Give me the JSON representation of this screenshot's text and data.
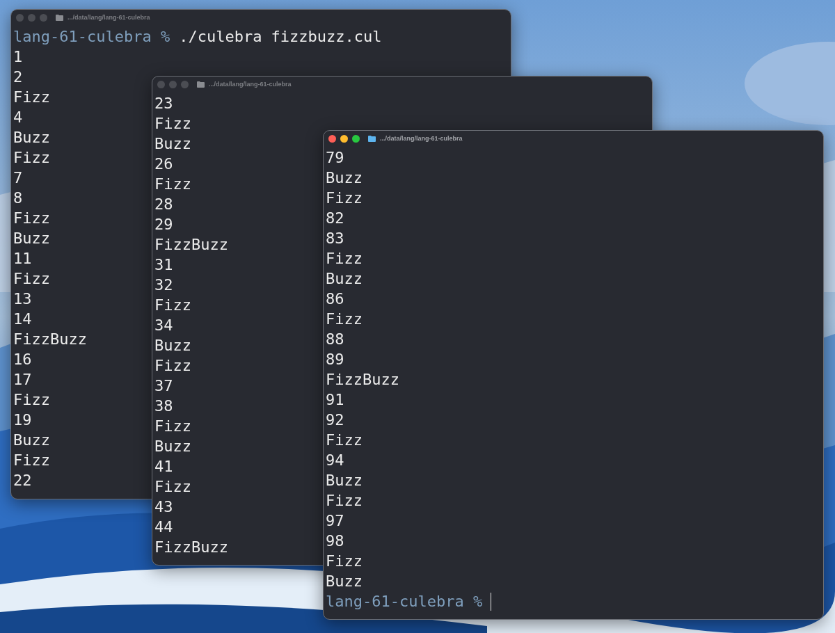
{
  "windows": [
    {
      "title": ".../data/lang/lang-61-culebra",
      "focused": false,
      "lines": [
        {
          "kind": "prompt",
          "prompt": "lang-61-culebra %",
          "command": "./culebra fizzbuzz.cul"
        },
        {
          "kind": "output",
          "text": "1"
        },
        {
          "kind": "output",
          "text": "2"
        },
        {
          "kind": "output",
          "text": "Fizz"
        },
        {
          "kind": "output",
          "text": "4"
        },
        {
          "kind": "output",
          "text": "Buzz"
        },
        {
          "kind": "output",
          "text": "Fizz"
        },
        {
          "kind": "output",
          "text": "7"
        },
        {
          "kind": "output",
          "text": "8"
        },
        {
          "kind": "output",
          "text": "Fizz"
        },
        {
          "kind": "output",
          "text": "Buzz"
        },
        {
          "kind": "output",
          "text": "11"
        },
        {
          "kind": "output",
          "text": "Fizz"
        },
        {
          "kind": "output",
          "text": "13"
        },
        {
          "kind": "output",
          "text": "14"
        },
        {
          "kind": "output",
          "text": "FizzBuzz"
        },
        {
          "kind": "output",
          "text": "16"
        },
        {
          "kind": "output",
          "text": "17"
        },
        {
          "kind": "output",
          "text": "Fizz"
        },
        {
          "kind": "output",
          "text": "19"
        },
        {
          "kind": "output",
          "text": "Buzz"
        },
        {
          "kind": "output",
          "text": "Fizz"
        },
        {
          "kind": "output",
          "text": "22"
        }
      ]
    },
    {
      "title": ".../data/lang/lang-61-culebra",
      "focused": false,
      "lines": [
        {
          "kind": "output",
          "text": "23"
        },
        {
          "kind": "output",
          "text": "Fizz"
        },
        {
          "kind": "output",
          "text": "Buzz"
        },
        {
          "kind": "output",
          "text": "26"
        },
        {
          "kind": "output",
          "text": "Fizz"
        },
        {
          "kind": "output",
          "text": "28"
        },
        {
          "kind": "output",
          "text": "29"
        },
        {
          "kind": "output",
          "text": "FizzBuzz"
        },
        {
          "kind": "output",
          "text": "31"
        },
        {
          "kind": "output",
          "text": "32"
        },
        {
          "kind": "output",
          "text": "Fizz"
        },
        {
          "kind": "output",
          "text": "34"
        },
        {
          "kind": "output",
          "text": "Buzz"
        },
        {
          "kind": "output",
          "text": "Fizz"
        },
        {
          "kind": "output",
          "text": "37"
        },
        {
          "kind": "output",
          "text": "38"
        },
        {
          "kind": "output",
          "text": "Fizz"
        },
        {
          "kind": "output",
          "text": "Buzz"
        },
        {
          "kind": "output",
          "text": "41"
        },
        {
          "kind": "output",
          "text": "Fizz"
        },
        {
          "kind": "output",
          "text": "43"
        },
        {
          "kind": "output",
          "text": "44"
        },
        {
          "kind": "output",
          "text": "FizzBuzz"
        }
      ]
    },
    {
      "title": ".../data/lang/lang-61-culebra",
      "focused": true,
      "lines": [
        {
          "kind": "output",
          "text": "79"
        },
        {
          "kind": "output",
          "text": "Buzz"
        },
        {
          "kind": "output",
          "text": "Fizz"
        },
        {
          "kind": "output",
          "text": "82"
        },
        {
          "kind": "output",
          "text": "83"
        },
        {
          "kind": "output",
          "text": "Fizz"
        },
        {
          "kind": "output",
          "text": "Buzz"
        },
        {
          "kind": "output",
          "text": "86"
        },
        {
          "kind": "output",
          "text": "Fizz"
        },
        {
          "kind": "output",
          "text": "88"
        },
        {
          "kind": "output",
          "text": "89"
        },
        {
          "kind": "output",
          "text": "FizzBuzz"
        },
        {
          "kind": "output",
          "text": "91"
        },
        {
          "kind": "output",
          "text": "92"
        },
        {
          "kind": "output",
          "text": "Fizz"
        },
        {
          "kind": "output",
          "text": "94"
        },
        {
          "kind": "output",
          "text": "Buzz"
        },
        {
          "kind": "output",
          "text": "Fizz"
        },
        {
          "kind": "output",
          "text": "97"
        },
        {
          "kind": "output",
          "text": "98"
        },
        {
          "kind": "output",
          "text": "Fizz"
        },
        {
          "kind": "output",
          "text": "Buzz"
        },
        {
          "kind": "prompt",
          "prompt": "lang-61-culebra %",
          "cursor": true
        }
      ]
    }
  ]
}
